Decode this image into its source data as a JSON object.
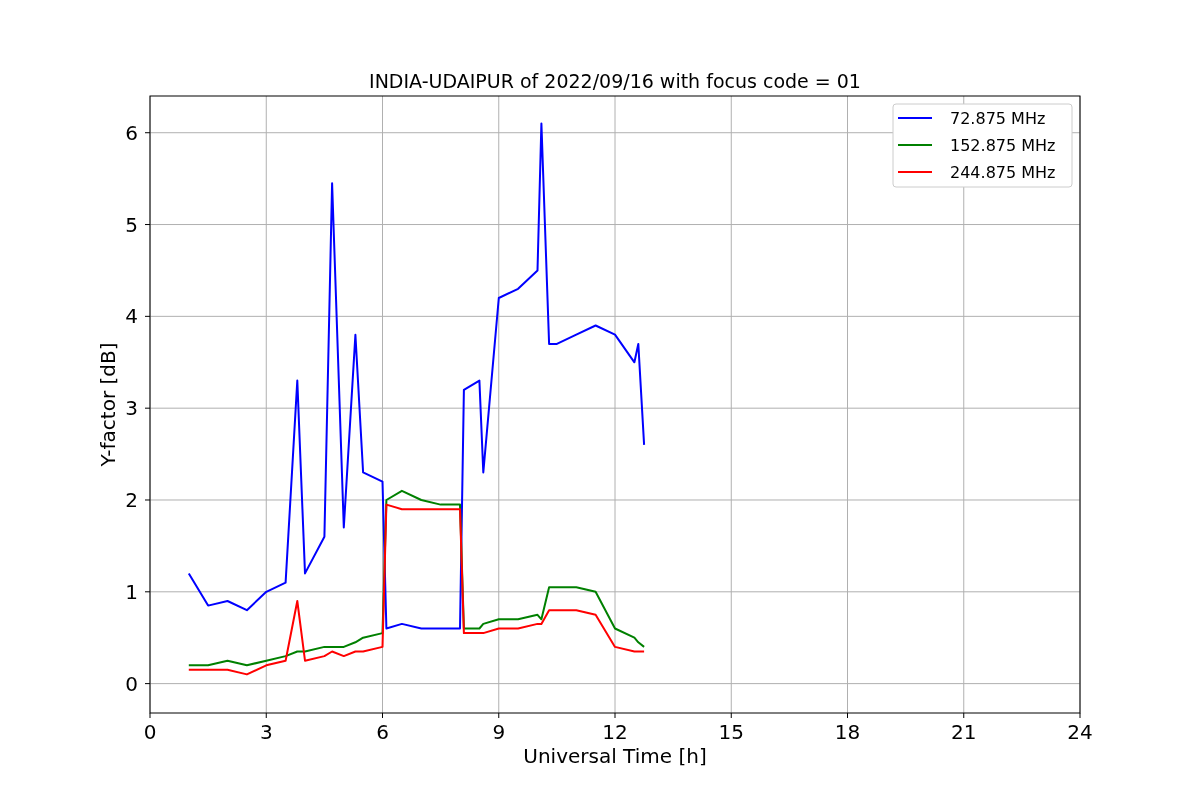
{
  "figure": {
    "chart_data": {
      "type": "line",
      "title": "INDIA-UDAIPUR of 2022/09/16 with focus code = 01",
      "xlabel": "Universal Time [h]",
      "ylabel": "Y-factor [dB]",
      "x": [
        1,
        1.5,
        2,
        2.5,
        3,
        3.5,
        3.8,
        4,
        4.5,
        4.7,
        5,
        5.3,
        5.5,
        6,
        6.1,
        6.5,
        7,
        7.5,
        8,
        8.1,
        8.5,
        8.6,
        9,
        9.5,
        10,
        10.1,
        10.3,
        10.5,
        11,
        11.5,
        12,
        12.5,
        12.6,
        12.75
      ],
      "series": [
        {
          "name": "72.875 MHz",
          "color": "#0000ff",
          "values": [
            1.2,
            0.85,
            0.9,
            0.8,
            1.0,
            1.1,
            3.3,
            1.2,
            1.6,
            5.45,
            1.7,
            3.8,
            2.3,
            2.2,
            0.6,
            0.65,
            0.6,
            0.6,
            0.6,
            3.2,
            3.3,
            2.3,
            4.2,
            4.3,
            4.5,
            6.1,
            3.7,
            3.7,
            3.8,
            3.9,
            3.8,
            3.5,
            3.7,
            2.6
          ]
        },
        {
          "name": "152.875 MHz",
          "color": "#008000",
          "values": [
            0.2,
            0.2,
            0.25,
            0.2,
            0.25,
            0.3,
            0.35,
            0.35,
            0.4,
            0.4,
            0.4,
            0.45,
            0.5,
            0.55,
            2.0,
            2.1,
            2.0,
            1.95,
            1.95,
            0.6,
            0.6,
            0.65,
            0.7,
            0.7,
            0.75,
            0.7,
            1.05,
            1.05,
            1.05,
            1.0,
            0.6,
            0.5,
            0.45,
            0.4
          ]
        },
        {
          "name": "244.875 MHz",
          "color": "#ff0000",
          "values": [
            0.15,
            0.15,
            0.15,
            0.1,
            0.2,
            0.25,
            0.9,
            0.25,
            0.3,
            0.35,
            0.3,
            0.35,
            0.35,
            0.4,
            1.95,
            1.9,
            1.9,
            1.9,
            1.9,
            0.55,
            0.55,
            0.55,
            0.6,
            0.6,
            0.65,
            0.65,
            0.8,
            0.8,
            0.8,
            0.75,
            0.4,
            0.35,
            0.35,
            0.35
          ]
        }
      ],
      "grid": true,
      "legend": true,
      "xlim": [
        0,
        24
      ],
      "ylim": [
        -0.32,
        6.4
      ],
      "xticks": [
        0,
        3,
        6,
        9,
        12,
        15,
        18,
        21,
        24
      ],
      "yticks": [
        0,
        1,
        2,
        3,
        4,
        5,
        6
      ]
    }
  }
}
